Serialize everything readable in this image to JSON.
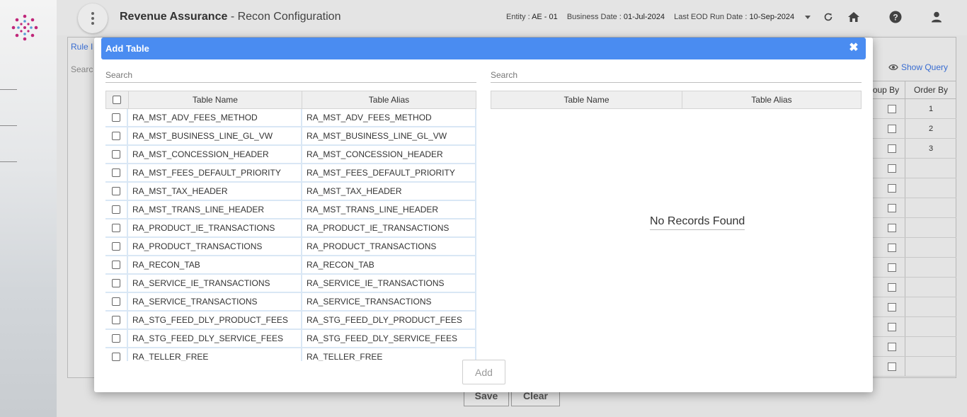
{
  "header": {
    "app_title": "Revenue Assurance",
    "page_title": " - Recon Configuration",
    "entity_label": "Entity : ",
    "entity_value": "AE - 01",
    "business_date_label": "Business Date : ",
    "business_date_value": "01-Jul-2024",
    "eod_label": "Last EOD Run Date : ",
    "eod_value": "10-Sep-2024",
    "icons": [
      "menu-icon",
      "refresh-icon",
      "home-icon",
      "help-icon",
      "user-icon"
    ]
  },
  "background": {
    "rule_tab": "Rule I",
    "search_placeholder": "Searc",
    "show_query": "Show Query",
    "grid_headers": [
      "oup By",
      "Order By"
    ],
    "order_values": [
      "1",
      "2",
      "3",
      "",
      "",
      "",
      "",
      "",
      "",
      "",
      "",
      "",
      "",
      ""
    ],
    "save_label": "Save",
    "clear_label": "Clear"
  },
  "modal": {
    "title": "Add Table",
    "left_search_placeholder": "Search",
    "right_search_placeholder": "Search",
    "left_headers": [
      "Table Name",
      "Table Alias"
    ],
    "right_headers": [
      "Table Name",
      "Table Alias"
    ],
    "rows": [
      {
        "name": "RA_MST_ADV_FEES_METHOD",
        "alias": "RA_MST_ADV_FEES_METHOD"
      },
      {
        "name": "RA_MST_BUSINESS_LINE_GL_VW",
        "alias": "RA_MST_BUSINESS_LINE_GL_VW"
      },
      {
        "name": "RA_MST_CONCESSION_HEADER",
        "alias": "RA_MST_CONCESSION_HEADER"
      },
      {
        "name": "RA_MST_FEES_DEFAULT_PRIORITY",
        "alias": "RA_MST_FEES_DEFAULT_PRIORITY"
      },
      {
        "name": "RA_MST_TAX_HEADER",
        "alias": "RA_MST_TAX_HEADER"
      },
      {
        "name": "RA_MST_TRANS_LINE_HEADER",
        "alias": "RA_MST_TRANS_LINE_HEADER"
      },
      {
        "name": "RA_PRODUCT_IE_TRANSACTIONS",
        "alias": "RA_PRODUCT_IE_TRANSACTIONS"
      },
      {
        "name": "RA_PRODUCT_TRANSACTIONS",
        "alias": "RA_PRODUCT_TRANSACTIONS"
      },
      {
        "name": "RA_RECON_TAB",
        "alias": "RA_RECON_TAB"
      },
      {
        "name": "RA_SERVICE_IE_TRANSACTIONS",
        "alias": "RA_SERVICE_IE_TRANSACTIONS"
      },
      {
        "name": "RA_SERVICE_TRANSACTIONS",
        "alias": "RA_SERVICE_TRANSACTIONS"
      },
      {
        "name": "RA_STG_FEED_DLY_PRODUCT_FEES",
        "alias": "RA_STG_FEED_DLY_PRODUCT_FEES"
      },
      {
        "name": "RA_STG_FEED_DLY_SERVICE_FEES",
        "alias": "RA_STG_FEED_DLY_SERVICE_FEES"
      },
      {
        "name": "RA_TELLER_FREE",
        "alias": "RA_TELLER_FREE"
      }
    ],
    "empty_message": "No Records Found",
    "add_label": "Add",
    "accent_color": "#4a8cf1"
  }
}
